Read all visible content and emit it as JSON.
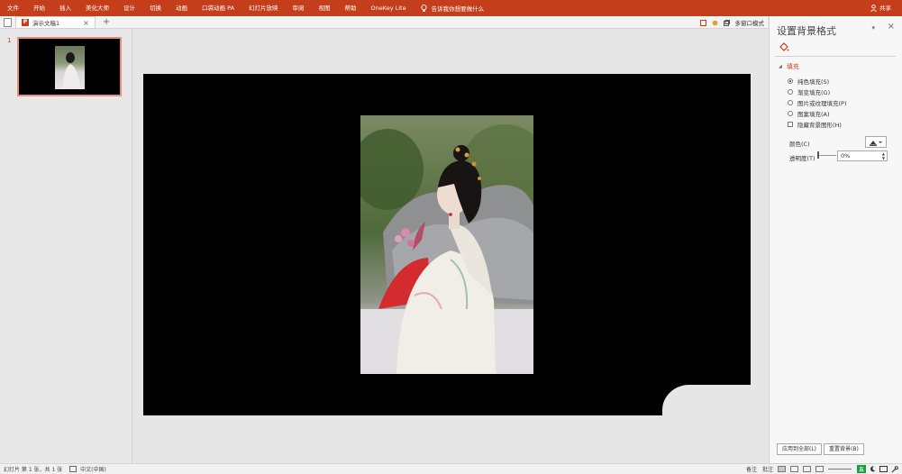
{
  "ribbon": {
    "tabs": [
      "文件",
      "开始",
      "插入",
      "美化大师",
      "设计",
      "切换",
      "动画",
      "口袋动画 PA",
      "幻灯片放映",
      "审阅",
      "视图",
      "帮助",
      "OneKey Lite"
    ],
    "tell_me": "告诉我你想要做什么",
    "share": "共享",
    "color": "#c43e1c"
  },
  "docbar": {
    "tab_title": "演示文稿1",
    "close": "×",
    "new_tab": "+",
    "multi_window": "多窗口模式"
  },
  "thumbnails": {
    "slides": [
      {
        "number": "1",
        "selected": true
      }
    ]
  },
  "pane": {
    "title": "设置背景格式",
    "section": "填充",
    "options": [
      {
        "label": "纯色填充(S)",
        "type": "radio",
        "checked": true
      },
      {
        "label": "渐变填充(G)",
        "type": "radio",
        "checked": false
      },
      {
        "label": "图片或纹理填充(P)",
        "type": "radio",
        "checked": false
      },
      {
        "label": "图案填充(A)",
        "type": "radio",
        "checked": false
      },
      {
        "label": "隐藏背景图形(H)",
        "type": "checkbox",
        "checked": false
      }
    ],
    "color_label": "颜色(C)",
    "transparency_label": "透明度(T)",
    "transparency_value": "0%",
    "apply_all": "应用到全部(L)",
    "reset": "重置背景(B)"
  },
  "status": {
    "slide_info": "幻灯片 第 1 张，共 1 张",
    "language": "中文(中国)",
    "notes": "备注",
    "comments": "批注",
    "ime": "五"
  }
}
